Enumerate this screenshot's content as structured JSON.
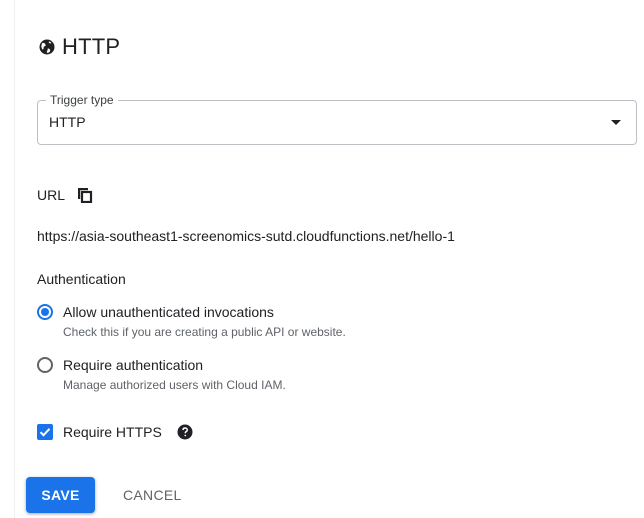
{
  "panel": {
    "title": "HTTP",
    "icon": "globe-icon"
  },
  "trigger": {
    "legend": "Trigger type",
    "value": "HTTP",
    "icon": "dropdown-arrow-icon"
  },
  "url": {
    "label": "URL",
    "copy_icon": "copy-icon",
    "value": "https://asia-southeast1-screenomics-sutd.cloudfunctions.net/hello-1"
  },
  "authentication": {
    "heading": "Authentication",
    "options": [
      {
        "label": "Allow unauthenticated invocations",
        "help": "Check this if you are creating a public API or website.",
        "selected": true
      },
      {
        "label": "Require authentication",
        "help": "Manage authorized users with Cloud IAM.",
        "selected": false
      }
    ]
  },
  "https": {
    "label": "Require HTTPS",
    "checked": true,
    "help_icon": "help-icon"
  },
  "actions": {
    "save_label": "SAVE",
    "cancel_label": "CANCEL"
  },
  "colors": {
    "accent": "#1a73e8",
    "text": "#202124",
    "secondary_text": "#5f6368",
    "outline": "#bdc1c6"
  }
}
